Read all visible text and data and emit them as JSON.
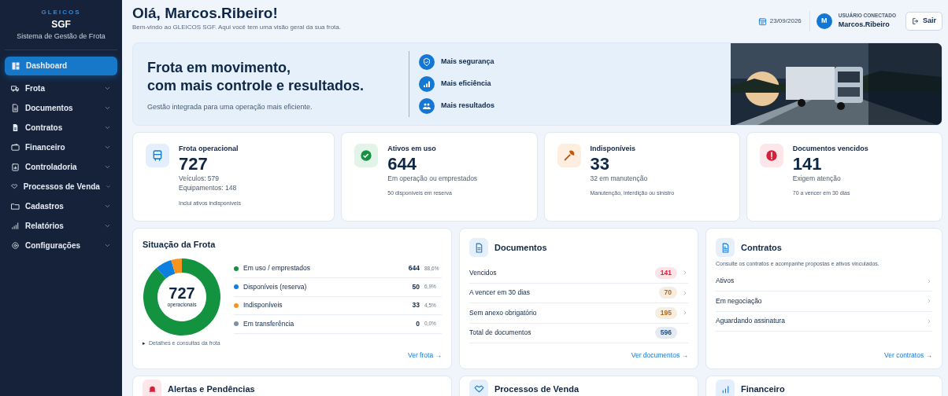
{
  "sidebar": {
    "brand": "GLEICOS",
    "product": "SGF",
    "subtitle": "Sistema de Gestão de Frota",
    "items": [
      {
        "label": "Dashboard",
        "selected": true,
        "has_submenu": false
      },
      {
        "label": "Frota",
        "selected": false,
        "has_submenu": true
      },
      {
        "label": "Documentos",
        "selected": false,
        "has_submenu": true
      },
      {
        "label": "Contratos",
        "selected": false,
        "has_submenu": true
      },
      {
        "label": "Financeiro",
        "selected": false,
        "has_submenu": true
      },
      {
        "label": "Controladoria",
        "selected": false,
        "has_submenu": true
      },
      {
        "label": "Processos de Venda",
        "selected": false,
        "has_submenu": true
      },
      {
        "label": "Cadastros",
        "selected": false,
        "has_submenu": true
      },
      {
        "label": "Relatórios",
        "selected": false,
        "has_submenu": true
      },
      {
        "label": "Configurações",
        "selected": false,
        "has_submenu": true
      }
    ]
  },
  "header": {
    "greeting": "Olá, Marcos.Ribeiro!",
    "welcome": "Bem-vindo ao GLEICOS SGF. Aqui você tem uma visão geral da sua frota.",
    "date": "23/09/2026",
    "avatar": "M",
    "user_caption": "USUÁRIO CONECTADO",
    "user_name": "Marcos.Ribeiro",
    "logout": "Sair"
  },
  "hero": {
    "title_lines": [
      "Frota em movimento,",
      "com mais controle e resultados."
    ],
    "subtitle": "Gestão integrada para uma operação mais eficiente.",
    "benefits": [
      "Mais segurança",
      "Mais eficiência",
      "Mais resultados"
    ]
  },
  "stats": [
    {
      "title": "Frota operacional",
      "value": "727",
      "lines": [
        "Veículos: 579",
        "Equipamentos: 148"
      ],
      "note": "Inclui ativos indisponíveis"
    },
    {
      "title": "Ativos em uso",
      "value": "644",
      "lines": [
        "Em operação ou emprestados"
      ],
      "note": "50 disponíveis em reserva"
    },
    {
      "title": "Indisponíveis",
      "value": "33",
      "lines": [
        "32 em manutenção"
      ],
      "note": "Manutenção, interdição ou sinistro"
    },
    {
      "title": "Documentos vencidos",
      "value": "141",
      "lines": [
        "Exigem atenção"
      ],
      "note": "70 a vencer em 30 dias"
    }
  ],
  "situacao": {
    "title": "Situação da Frota",
    "center_value": "727",
    "center_label": "operacionais",
    "chart_data": {
      "type": "donut",
      "categories": [
        "Em uso / emprestados",
        "Disponíveis (reserva)",
        "Indisponíveis",
        "Em transferência"
      ],
      "series": [
        {
          "values": [
            88.6,
            6.9,
            4.5,
            0
          ]
        }
      ]
    },
    "legend": [
      {
        "value": "644",
        "percent": "88,6%",
        "color": "#13923f"
      },
      {
        "value": "50",
        "percent": "6,9%",
        "color": "#0d7fe0"
      },
      {
        "value": "33",
        "percent": "4,5%",
        "color": "#f7941d"
      },
      {
        "value": "0",
        "percent": "0,0%",
        "color": "#7b8fa8"
      }
    ],
    "details": "Detalhes e consultas da frota",
    "details_marker": "▸",
    "link": "Ver frota",
    "link_arrow": "→"
  },
  "documentos": {
    "title": "Documentos",
    "rows": [
      {
        "label": "Vencidos",
        "count": "141",
        "color": "#d6203a",
        "has_arrow": true
      },
      {
        "label": "A vencer em 30 dias",
        "count": "70",
        "color": "#b8680a",
        "has_arrow": true
      },
      {
        "label": "Sem anexo obrigatório",
        "count": "195",
        "color": "#b8680a",
        "has_arrow": true
      },
      {
        "label": "Total de documentos",
        "count": "596",
        "color": "#1e4f86",
        "has_arrow": false
      }
    ],
    "link": "Ver documentos",
    "link_arrow": "→"
  },
  "contratos": {
    "title": "Contratos",
    "description": "Consulte os contratos e acompanhe propostas e ativos vinculados.",
    "rows": [
      "Ativos",
      "Em negociação",
      "Aguardando assinatura"
    ],
    "link": "Ver contratos",
    "link_arrow": "→"
  },
  "next_cards": [
    "Alertas e Pendências",
    "Processos de Venda",
    "Financeiro"
  ]
}
